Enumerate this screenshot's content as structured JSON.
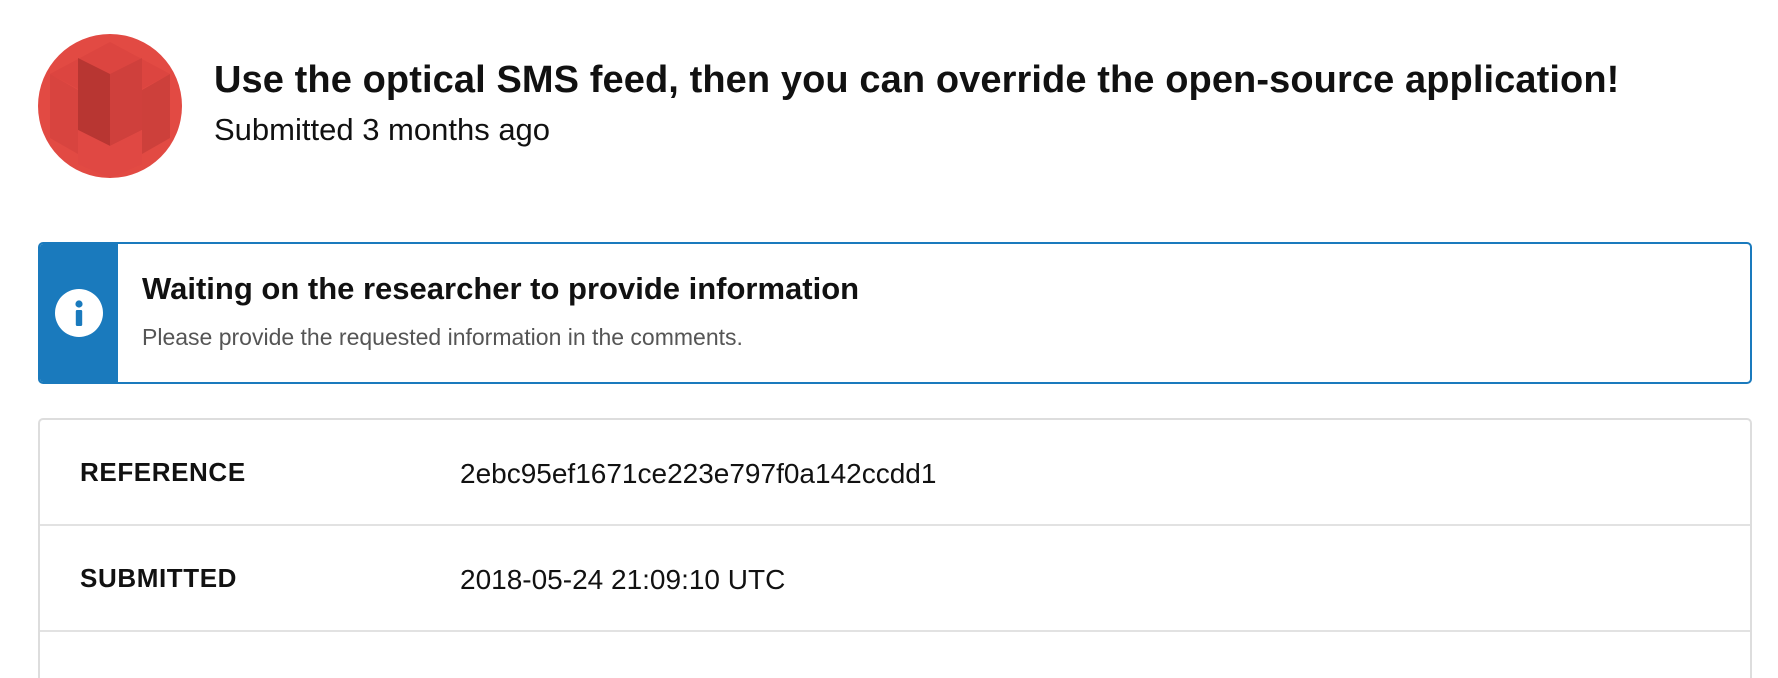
{
  "header": {
    "title": "Use the optical SMS feed, then you can override the open-source application!",
    "submitted_ago": "Submitted 3 months ago",
    "avatar_icon": "avatar-geometric-icon"
  },
  "status": {
    "title": "Waiting on the researcher to provide information",
    "message": "Please provide the requested information in the comments.",
    "icon": "info-icon",
    "accent_color": "#1a7abd"
  },
  "details": [
    {
      "label": "REFERENCE",
      "value": "2ebc95ef1671ce223e797f0a142ccdd1"
    },
    {
      "label": "SUBMITTED",
      "value": "2018-05-24 21:09:10 UTC"
    }
  ],
  "colors": {
    "avatar": "#e24a43",
    "info": "#1a7abd",
    "border": "#dddddd"
  }
}
